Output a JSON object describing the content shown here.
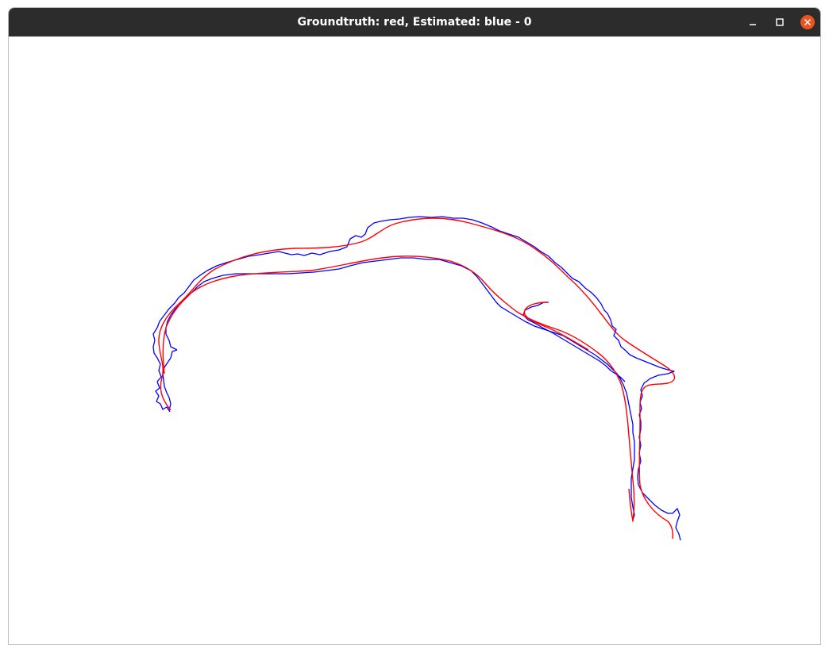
{
  "window": {
    "title": "Groundtruth: red, Estimated: blue - 0"
  },
  "colors": {
    "titlebar": "#2c2c2c",
    "close_button": "#e95420",
    "groundtruth": "#ff0000",
    "estimated": "#0000ff"
  },
  "icons": {
    "minimize": "minimize-icon",
    "maximize": "maximize-icon",
    "close": "close-icon"
  }
}
